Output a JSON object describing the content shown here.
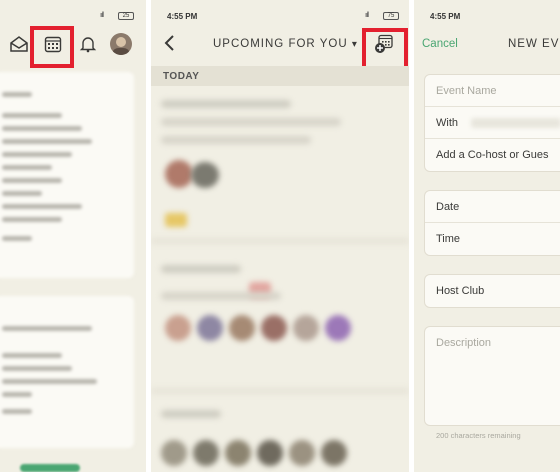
{
  "panel1": {
    "status": {
      "signal": "ııll",
      "battery": "25"
    },
    "toolbar_icons": [
      "envelope-icon",
      "calendar-icon",
      "bell-icon",
      "avatar"
    ]
  },
  "panel2": {
    "status": {
      "time": "4:55 PM",
      "signal": "ııll",
      "battery": "75"
    },
    "title": "UPCOMING FOR YOU",
    "title_caret": "▾",
    "section_label": "TODAY",
    "back_glyph": "‹"
  },
  "panel3": {
    "status": {
      "time": "4:55 PM"
    },
    "cancel_label": "Cancel",
    "title": "NEW EVE",
    "fields": {
      "event_name_placeholder": "Event Name",
      "with_label": "With",
      "cohost_label": "Add a Co-host or Gues",
      "date_label": "Date",
      "time_label": "Time",
      "host_club_label": "Host Club",
      "description_placeholder": "Description",
      "chars_remaining": "200 characters remaining"
    }
  },
  "colors": {
    "highlight": "#e3202f",
    "accent_green": "#4aa672",
    "background": "#f1efe4"
  }
}
